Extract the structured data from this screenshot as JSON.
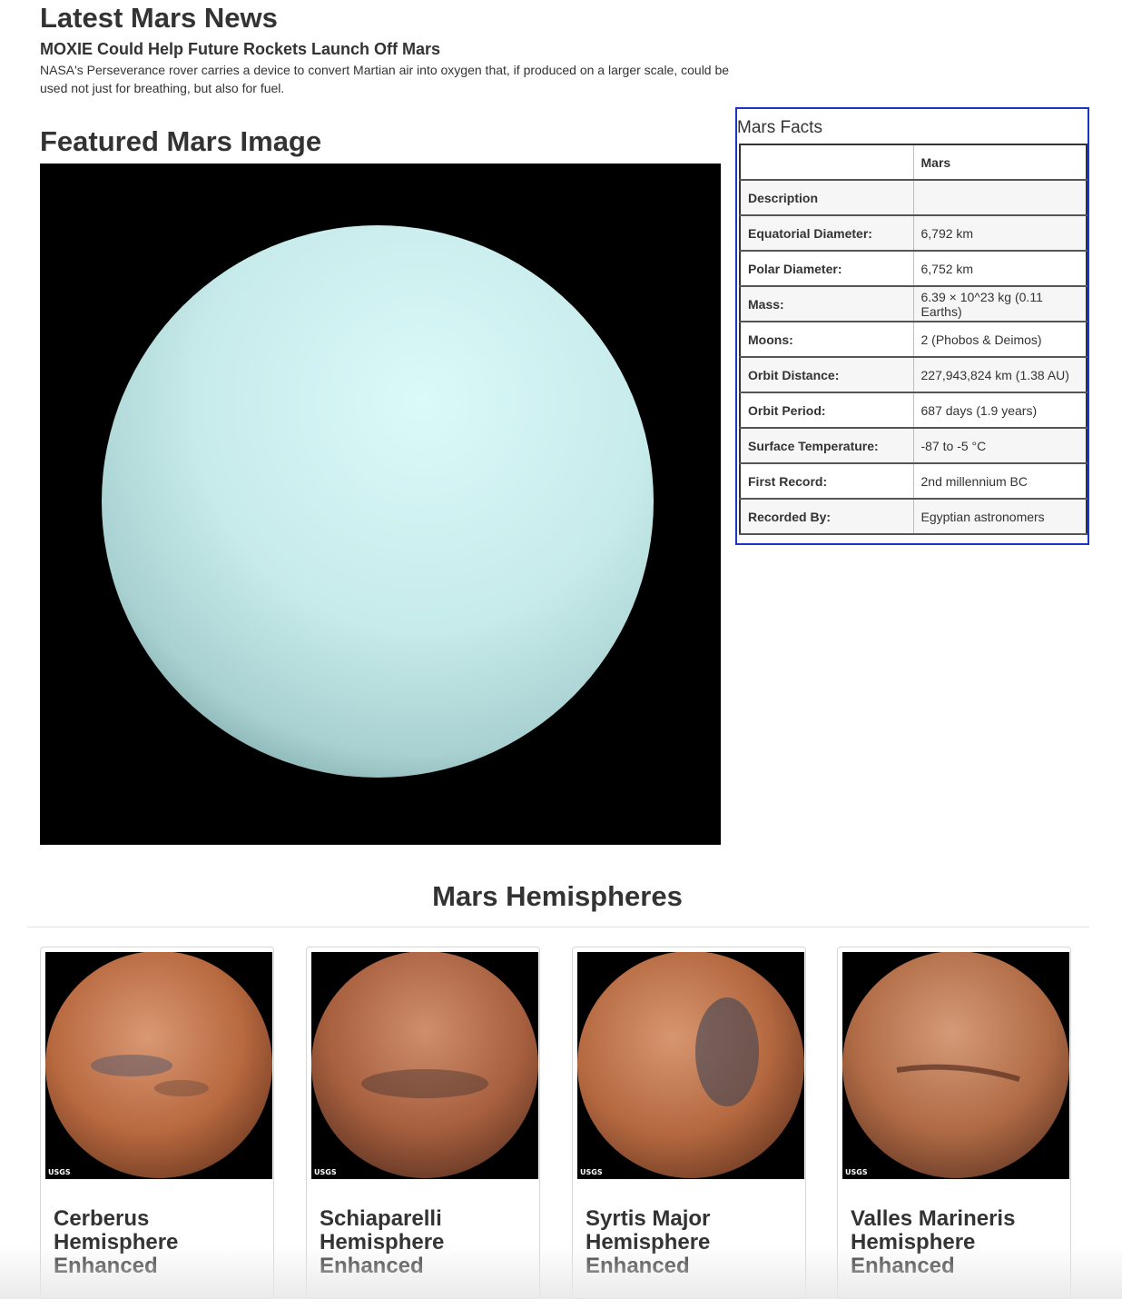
{
  "news": {
    "section_title": "Latest Mars News",
    "headline": "MOXIE Could Help Future Rockets Launch Off Mars",
    "teaser": "NASA's Perseverance rover carries a device to convert Martian air into oxygen that, if produced on a larger scale, could be used not just for breathing, but also for fuel."
  },
  "featured": {
    "section_title": "Featured Mars Image"
  },
  "facts": {
    "title": "Mars Facts",
    "column_header": "Mars",
    "rows": [
      {
        "label": "Description",
        "value": ""
      },
      {
        "label": "Equatorial Diameter:",
        "value": "6,792 km"
      },
      {
        "label": "Polar Diameter:",
        "value": "6,752 km"
      },
      {
        "label": "Mass:",
        "value": "6.39 × 10^23 kg (0.11 Earths)"
      },
      {
        "label": "Moons:",
        "value": "2 (Phobos & Deimos)"
      },
      {
        "label": "Orbit Distance:",
        "value": "227,943,824 km (1.38 AU)"
      },
      {
        "label": "Orbit Period:",
        "value": "687 days (1.9 years)"
      },
      {
        "label": "Surface Temperature:",
        "value": "-87 to -5 °C"
      },
      {
        "label": "First Record:",
        "value": "2nd millennium BC"
      },
      {
        "label": "Recorded By:",
        "value": "Egyptian astronomers"
      }
    ]
  },
  "hemispheres": {
    "section_title": "Mars Hemispheres",
    "logo_text": "USGS",
    "items": [
      {
        "title": "Cerberus Hemisphere Enhanced"
      },
      {
        "title": "Schiaparelli Hemisphere Enhanced"
      },
      {
        "title": "Syrtis Major Hemisphere Enhanced"
      },
      {
        "title": "Valles Marineris Hemisphere Enhanced"
      }
    ]
  },
  "colors": {
    "facts_border": "#1c35c7",
    "heading_text": "#333333",
    "featured_planet": "#c9ecec",
    "mars_surface": "#b86a47"
  }
}
